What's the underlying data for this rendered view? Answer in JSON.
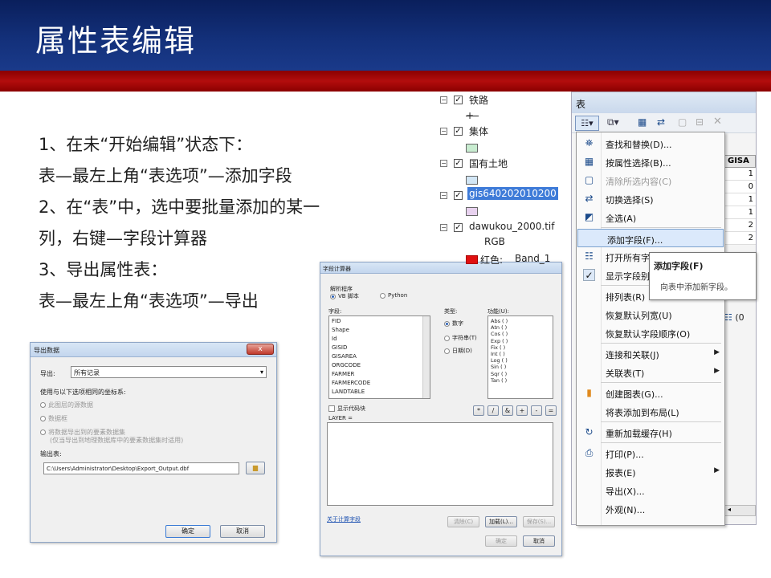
{
  "slide": {
    "title": "属性表编辑",
    "lines": [
      "1、在未“开始编辑”状态下：",
      "表—最左上角“表选项”—添加字段",
      "2、在“表”中，选中要批量添加的某一",
      "列，右键—字段计算器",
      "3、导出属性表：",
      "表—最左上角“表选项”—导出"
    ]
  },
  "export_dialog": {
    "title": "导出数据",
    "close": "x",
    "export_label": "导出:",
    "export_value": "所有记录",
    "coord_label": "使用与以下选项相同的坐标系:",
    "options": [
      "此图层的源数据",
      "数据框",
      "将数据导出到的要素数据集",
      "(仅当导出到地理数据库中的要素数据集时适用)"
    ],
    "output_label": "输出表:",
    "output_path": "C:\\Users\\Administrator\\Desktop\\Export_Output.dbf",
    "ok": "确定",
    "cancel": "取消"
  },
  "field_calc": {
    "title": "字段计算器",
    "parser_label": "解析程序",
    "parser_vb": "VB 脚本",
    "parser_py": "Python",
    "fields_label": "字段:",
    "fields": [
      "FID",
      "Shape",
      "Id",
      "GISID",
      "GISAREA",
      "ORGCODE",
      "FARMER",
      "FARMERCODE",
      "LANDTABLE"
    ],
    "type_label": "类型:",
    "types": [
      "数字",
      "字符串(T)",
      "日期(D)"
    ],
    "func_label": "功能(U):",
    "functions": [
      "Abs ( )",
      "Atn ( )",
      "Cos ( )",
      "Exp ( )",
      "Fix ( )",
      "Int ( )",
      "Log ( )",
      "Sin ( )",
      "Sqr ( )",
      "Tan ( )"
    ],
    "show_code": "显示代码块",
    "layer_expr": "LAYER =",
    "ops": [
      "*",
      "/",
      "&",
      "+",
      "-",
      "="
    ],
    "about": "关于计算字段",
    "clear": "清除(C)",
    "load": "加载(L)...",
    "save": "保存(S)...",
    "ok": "确定",
    "cancel": "取消"
  },
  "toc": {
    "layers": [
      "铁路",
      "集体",
      "国有土地",
      "gis640202010200",
      "dawukou_2000.tif"
    ],
    "rgb": "RGB",
    "red_label": "红色:",
    "band": "Band_1",
    "colors": {
      "collective": "#c8ecd0",
      "state": "#d2e6f5",
      "gis": "#e8d2ef",
      "red": "#e01010"
    }
  },
  "table_window": {
    "title": "表",
    "column_header": "GISA",
    "column_values": [
      "1",
      "0",
      "1",
      "1",
      "2",
      "2"
    ],
    "status_fragment": "(0",
    "menu": [
      {
        "label": "查找和替换(D)...",
        "icon": "binoculars-icon",
        "glyph": "⛯"
      },
      {
        "label": "按属性选择(B)...",
        "icon": "select-by-attributes-icon",
        "glyph": "▦"
      },
      {
        "label": "清除所选内容(C)",
        "icon": "clear-selection-icon",
        "glyph": "▢",
        "disabled": true
      },
      {
        "label": "切换选择(S)",
        "icon": "switch-selection-icon",
        "glyph": "⇄"
      },
      {
        "label": "全选(A)",
        "icon": "select-all-icon",
        "glyph": "◩"
      },
      {
        "label": "添加字段(F)...",
        "icon": "",
        "glyph": "",
        "highlighted": true
      },
      {
        "label": "打开所有字",
        "icon": "fields-icon",
        "glyph": "☷"
      },
      {
        "label": "显示字段别",
        "icon": "check-icon",
        "glyph": "✓"
      },
      {
        "label": "排列表(R)",
        "icon": "",
        "glyph": ""
      },
      {
        "label": "恢复默认列宽(U)",
        "icon": "",
        "glyph": ""
      },
      {
        "label": "恢复默认字段顺序(O)",
        "icon": "",
        "glyph": ""
      },
      {
        "label": "连接和关联(J)",
        "icon": "",
        "glyph": "",
        "submenu": true
      },
      {
        "label": "关联表(T)",
        "icon": "",
        "glyph": "",
        "submenu": true
      },
      {
        "label": "创建图表(G)...",
        "icon": "chart-icon",
        "glyph": "▮"
      },
      {
        "label": "将表添加到布局(L)",
        "icon": "",
        "glyph": ""
      },
      {
        "label": "重新加载缓存(H)",
        "icon": "reload-icon",
        "glyph": "↻"
      },
      {
        "label": "打印(P)...",
        "icon": "print-icon",
        "glyph": "⎙"
      },
      {
        "label": "报表(E)",
        "icon": "",
        "glyph": "",
        "submenu": true
      },
      {
        "label": "导出(X)...",
        "icon": "",
        "glyph": ""
      },
      {
        "label": "外观(N)...",
        "icon": "",
        "glyph": ""
      }
    ],
    "tooltip_title": "添加字段(F)",
    "tooltip_desc": "向表中添加新字段。"
  }
}
